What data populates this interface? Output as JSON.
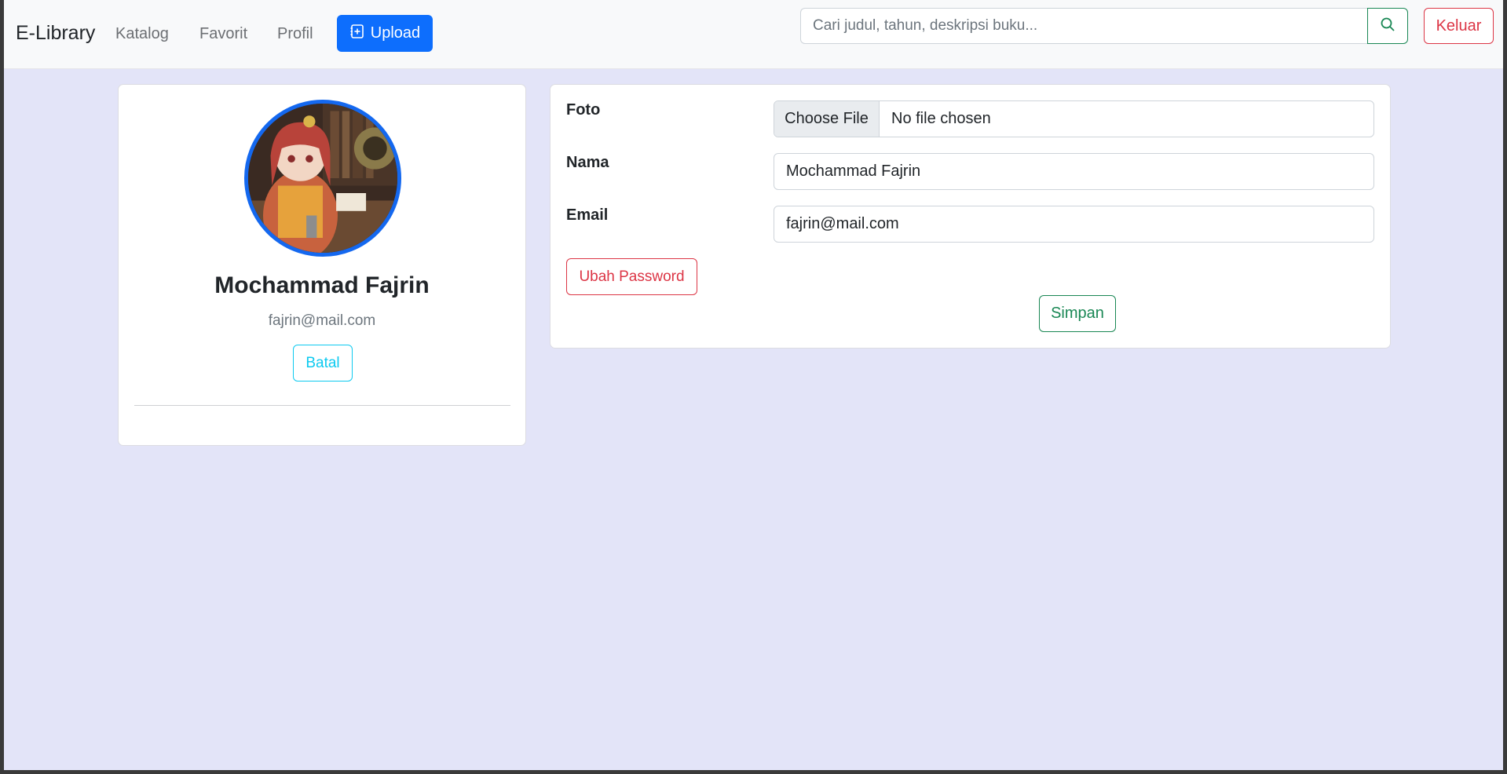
{
  "navbar": {
    "brand": "E-Library",
    "links": [
      "Katalog",
      "Favorit",
      "Profil"
    ],
    "upload_label": "Upload",
    "search_placeholder": "Cari judul, tahun, deskripsi buku...",
    "search_icon": "search-icon",
    "logout_label": "Keluar"
  },
  "profile": {
    "name": "Mochammad Fajrin",
    "email": "fajrin@mail.com",
    "cancel_label": "Batal"
  },
  "form": {
    "photo_label": "Foto",
    "file_button": "Choose File",
    "file_status": "No file chosen",
    "name_label": "Nama",
    "name_value": "Mochammad Fajrin",
    "email_label": "Email",
    "email_value": "fajrin@mail.com",
    "change_password_label": "Ubah Password",
    "save_label": "Simpan"
  },
  "colors": {
    "primary": "#0d6efd",
    "success": "#198754",
    "danger": "#dc3545",
    "info": "#0dcaf0",
    "background": "#e3e4f8"
  }
}
